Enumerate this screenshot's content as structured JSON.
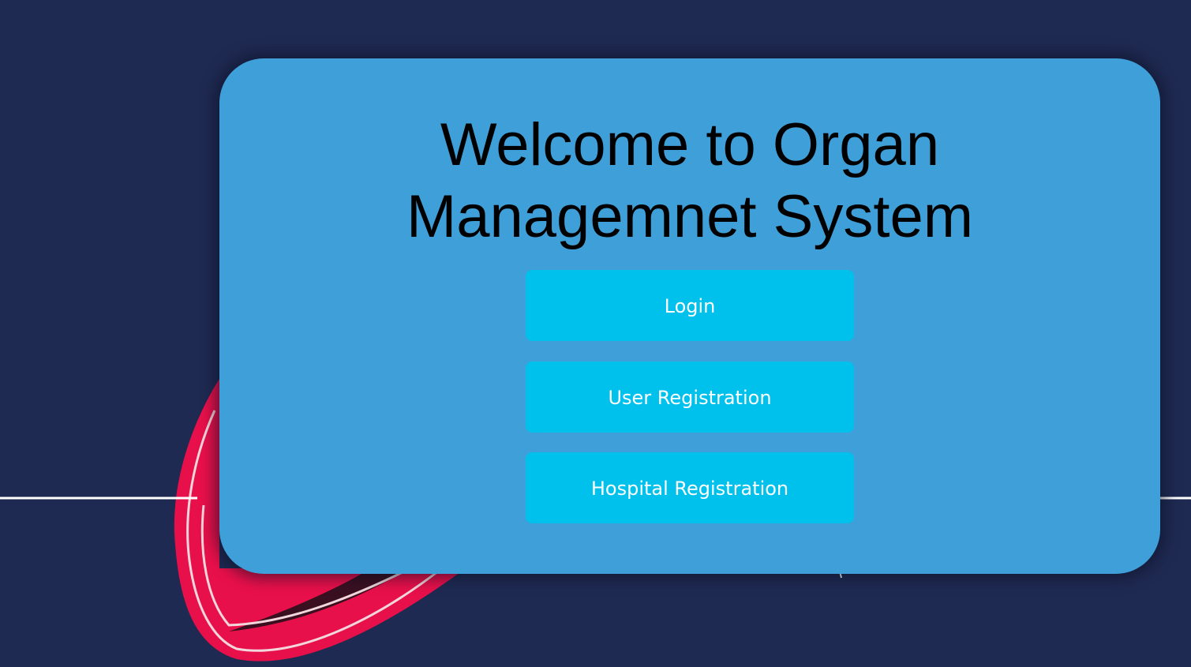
{
  "page": {
    "title_line1": "Welcome to Organ",
    "title_line2": "Managemnet System"
  },
  "buttons": {
    "login_label": "Login",
    "user_registration_label": "User Registration",
    "hospital_registration_label": "Hospital Registration"
  },
  "colors": {
    "background": "#1f2a52",
    "card": "#3f9fd8",
    "button": "#00c1ec",
    "button_text": "#ffffff",
    "title_text": "#000000",
    "heart_accent": "#e8104a",
    "pulse_line": "#ffffff"
  },
  "icons": {
    "background_art": "heart-pulse-icon"
  }
}
